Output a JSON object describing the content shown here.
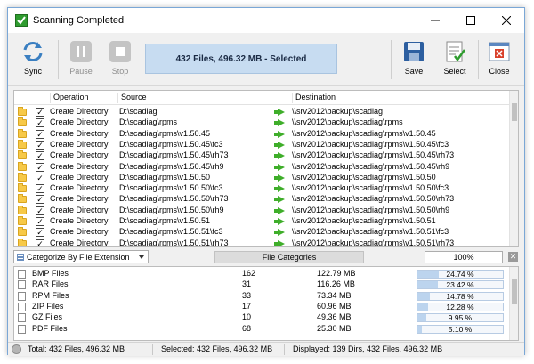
{
  "window": {
    "title": "Scanning Completed"
  },
  "toolbar": {
    "sync_label": "Sync",
    "pause_label": "Pause",
    "stop_label": "Stop",
    "status": "432 Files, 496.32 MB - Selected",
    "save_label": "Save",
    "select_label": "Select",
    "close_label": "Close"
  },
  "operations": {
    "columns": {
      "operation": "Operation",
      "source": "Source",
      "destination": "Destination"
    },
    "rows": [
      {
        "operation": "Create Directory",
        "source": "D:\\scadiag",
        "destination": "\\\\srv2012\\backup\\scadiag"
      },
      {
        "operation": "Create Directory",
        "source": "D:\\scadiag\\rpms",
        "destination": "\\\\srv2012\\backup\\scadiag\\rpms"
      },
      {
        "operation": "Create Directory",
        "source": "D:\\scadiag\\rpms\\v1.50.45",
        "destination": "\\\\srv2012\\backup\\scadiag\\rpms\\v1.50.45"
      },
      {
        "operation": "Create Directory",
        "source": "D:\\scadiag\\rpms\\v1.50.45\\fc3",
        "destination": "\\\\srv2012\\backup\\scadiag\\rpms\\v1.50.45\\fc3"
      },
      {
        "operation": "Create Directory",
        "source": "D:\\scadiag\\rpms\\v1.50.45\\rh73",
        "destination": "\\\\srv2012\\backup\\scadiag\\rpms\\v1.50.45\\rh73"
      },
      {
        "operation": "Create Directory",
        "source": "D:\\scadiag\\rpms\\v1.50.45\\rh9",
        "destination": "\\\\srv2012\\backup\\scadiag\\rpms\\v1.50.45\\rh9"
      },
      {
        "operation": "Create Directory",
        "source": "D:\\scadiag\\rpms\\v1.50.50",
        "destination": "\\\\srv2012\\backup\\scadiag\\rpms\\v1.50.50"
      },
      {
        "operation": "Create Directory",
        "source": "D:\\scadiag\\rpms\\v1.50.50\\fc3",
        "destination": "\\\\srv2012\\backup\\scadiag\\rpms\\v1.50.50\\fc3"
      },
      {
        "operation": "Create Directory",
        "source": "D:\\scadiag\\rpms\\v1.50.50\\rh73",
        "destination": "\\\\srv2012\\backup\\scadiag\\rpms\\v1.50.50\\rh73"
      },
      {
        "operation": "Create Directory",
        "source": "D:\\scadiag\\rpms\\v1.50.50\\rh9",
        "destination": "\\\\srv2012\\backup\\scadiag\\rpms\\v1.50.50\\rh9"
      },
      {
        "operation": "Create Directory",
        "source": "D:\\scadiag\\rpms\\v1.50.51",
        "destination": "\\\\srv2012\\backup\\scadiag\\rpms\\v1.50.51"
      },
      {
        "operation": "Create Directory",
        "source": "D:\\scadiag\\rpms\\v1.50.51\\fc3",
        "destination": "\\\\srv2012\\backup\\scadiag\\rpms\\v1.50.51\\fc3"
      },
      {
        "operation": "Create Directory",
        "source": "D:\\scadiag\\rpms\\v1.50.51\\rh73",
        "destination": "\\\\srv2012\\backup\\scadiag\\rpms\\v1.50.51\\rh73"
      }
    ]
  },
  "categories_bar": {
    "selector": "Categorize By File Extension",
    "title": "File Categories",
    "percent": "100%"
  },
  "categories": [
    {
      "name": "BMP Files",
      "count": "162",
      "size": "122.79 MB",
      "percent": "24.74 %",
      "fraction": 0.2474
    },
    {
      "name": "RAR Files",
      "count": "31",
      "size": "116.26 MB",
      "percent": "23.42 %",
      "fraction": 0.2342
    },
    {
      "name": "RPM Files",
      "count": "33",
      "size": "73.34 MB",
      "percent": "14.78 %",
      "fraction": 0.1478
    },
    {
      "name": "ZIP Files",
      "count": "17",
      "size": "60.96 MB",
      "percent": "12.28 %",
      "fraction": 0.1228
    },
    {
      "name": "GZ Files",
      "count": "10",
      "size": "49.36 MB",
      "percent": "9.95 %",
      "fraction": 0.0995
    },
    {
      "name": "PDF Files",
      "count": "68",
      "size": "25.30 MB",
      "percent": "5.10 %",
      "fraction": 0.051
    }
  ],
  "statusbar": {
    "total": "Total: 432 Files, 496.32 MB",
    "selected": "Selected: 432 Files, 496.32 MB",
    "displayed": "Displayed: 139 Dirs, 432 Files, 496.32 MB"
  },
  "colors": {
    "status_box": "#c7dcf1",
    "arrow": "#3fae2a",
    "folder": "#f7c948",
    "bar_fill": "#bcd4ee"
  }
}
